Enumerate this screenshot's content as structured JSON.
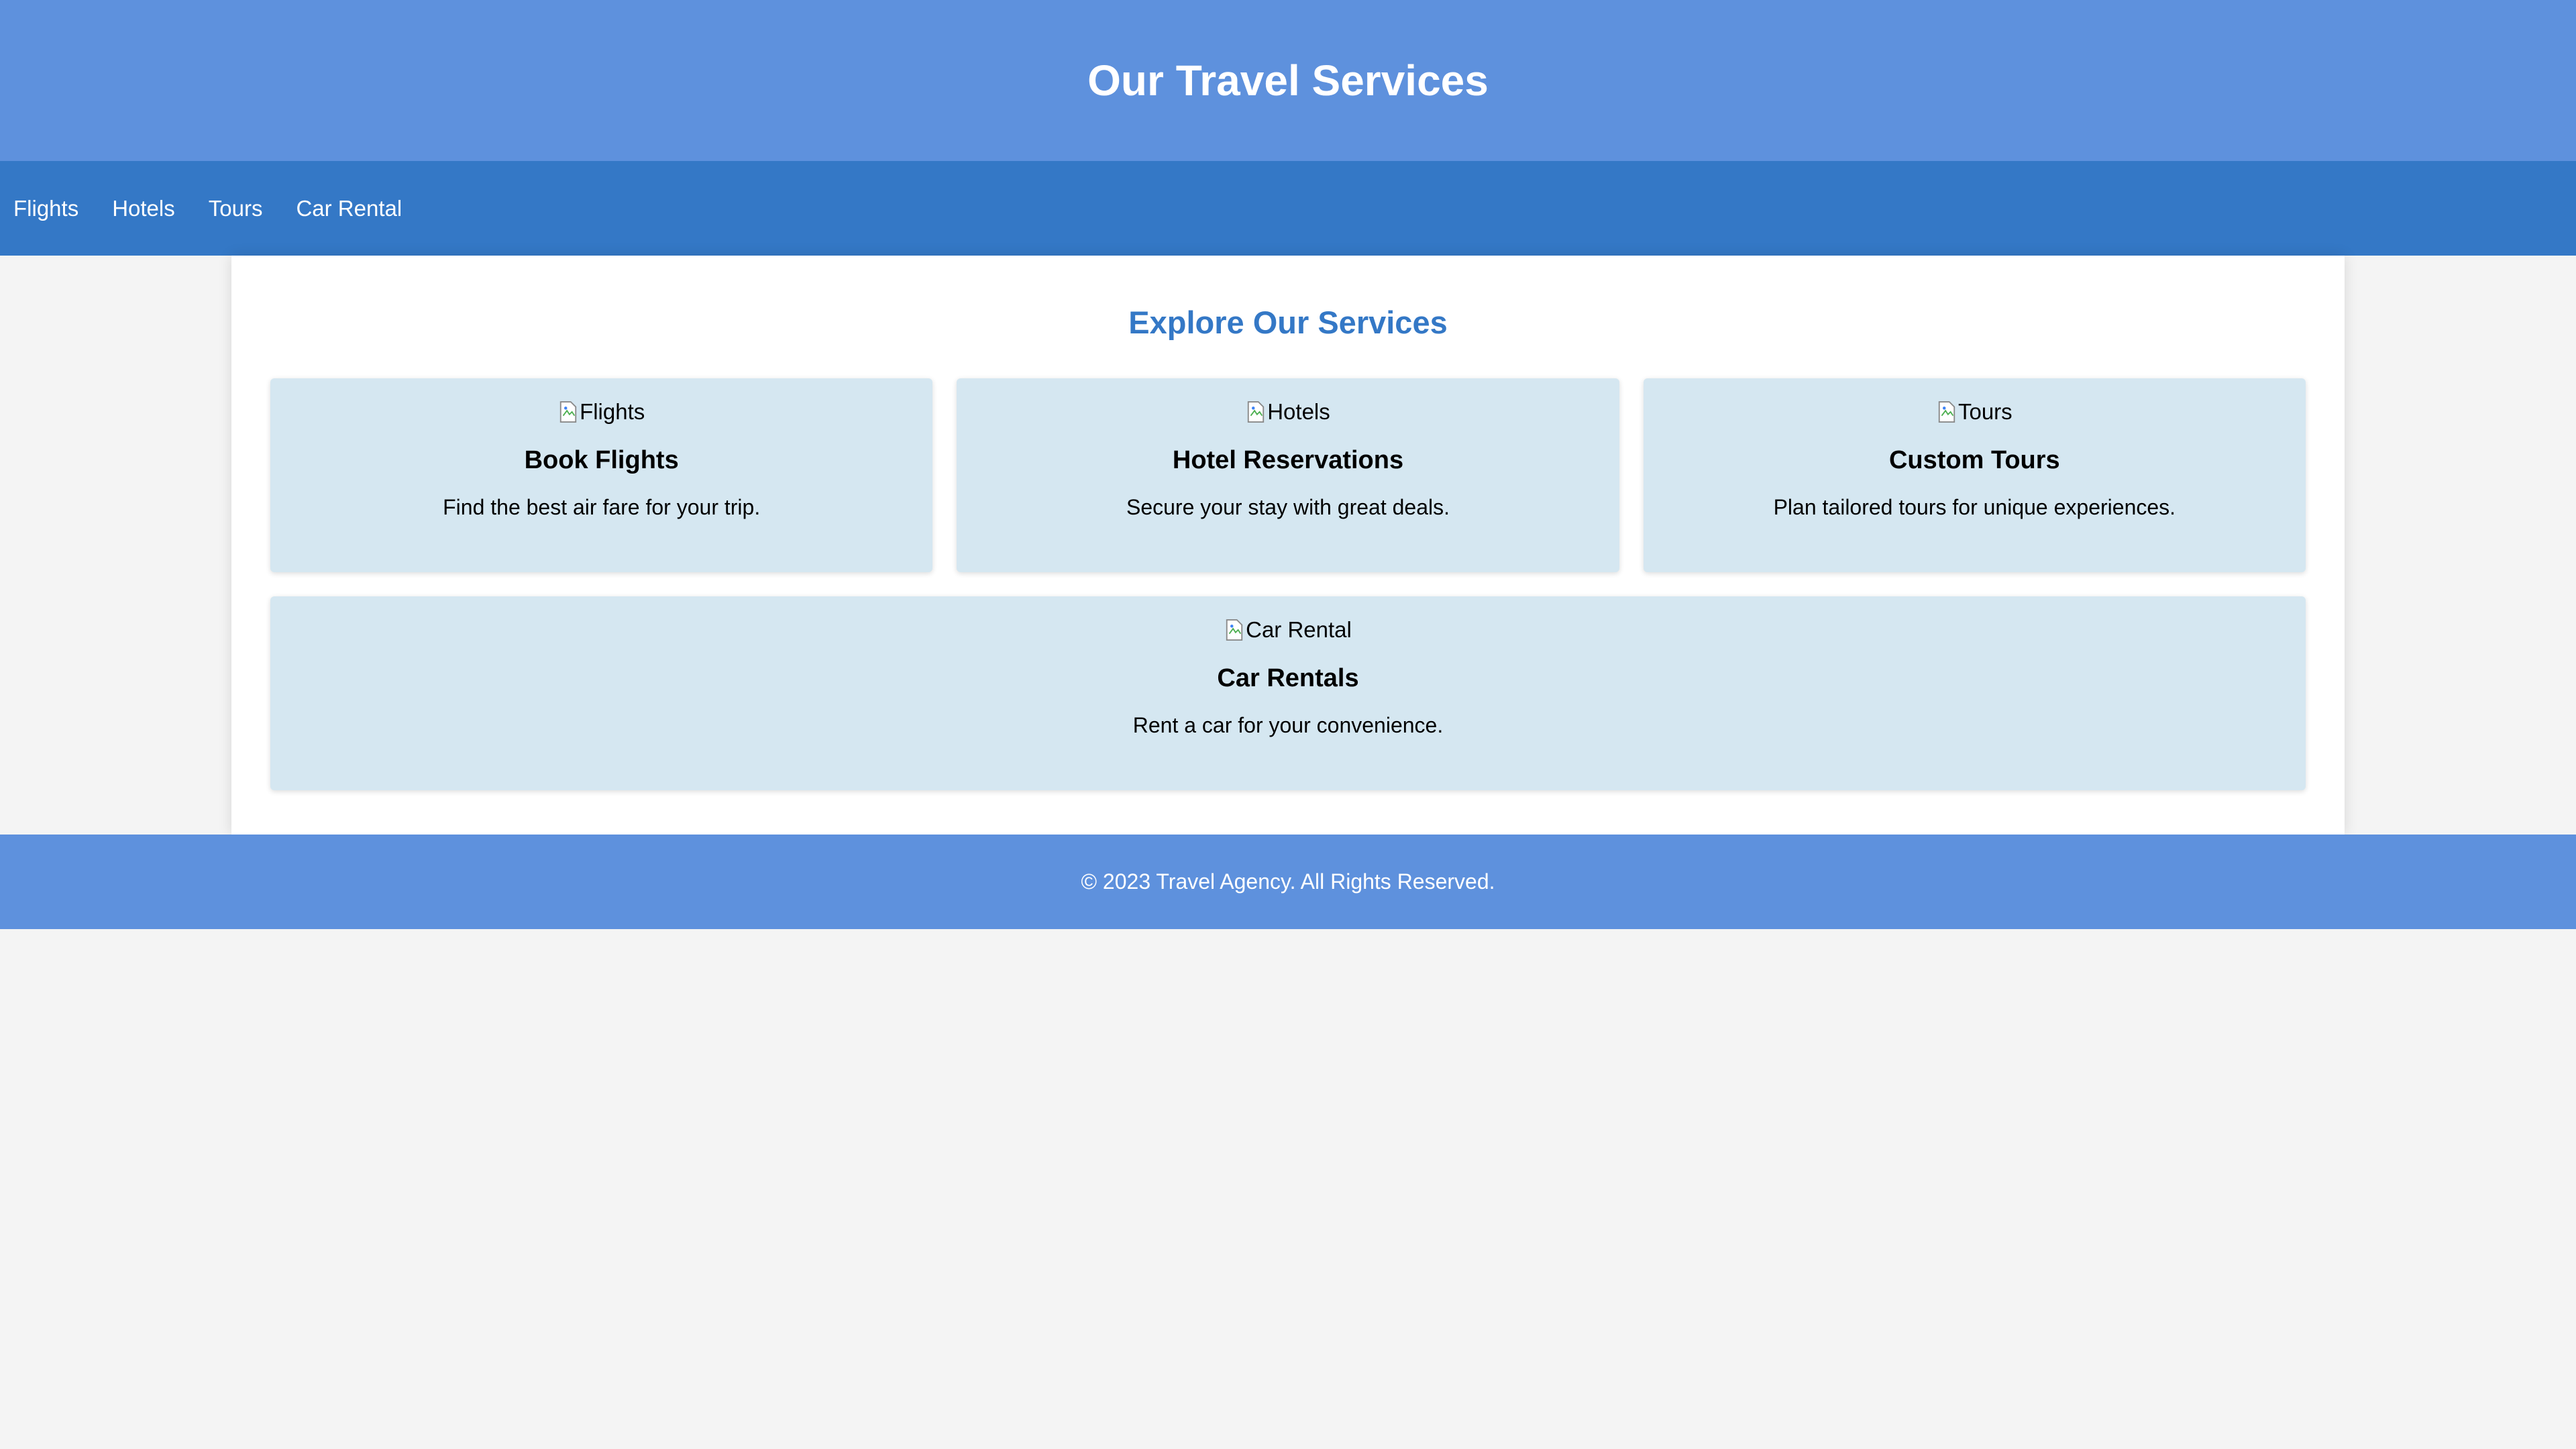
{
  "header": {
    "title": "Our Travel Services"
  },
  "nav": {
    "items": [
      {
        "label": "Flights"
      },
      {
        "label": "Hotels"
      },
      {
        "label": "Tours"
      },
      {
        "label": "Car Rental"
      }
    ]
  },
  "main": {
    "section_title": "Explore Our Services",
    "cards": [
      {
        "image_alt": "Flights",
        "title": "Book Flights",
        "text": "Find the best air fare for your trip."
      },
      {
        "image_alt": "Hotels",
        "title": "Hotel Reservations",
        "text": "Secure your stay with great deals."
      },
      {
        "image_alt": "Tours",
        "title": "Custom Tours",
        "text": "Plan tailored tours for unique experiences."
      },
      {
        "image_alt": "Car Rental",
        "title": "Car Rentals",
        "text": "Rent a car for your convenience."
      }
    ]
  },
  "footer": {
    "text": "© 2023 Travel Agency. All Rights Reserved."
  },
  "colors": {
    "header_bg": "#5e91dd",
    "nav_bg": "#3478c6",
    "accent": "#3478c6",
    "card_bg": "#d5e7f1",
    "page_bg": "#f4f4f4"
  },
  "icons": {
    "card_image": "broken-image-icon"
  }
}
